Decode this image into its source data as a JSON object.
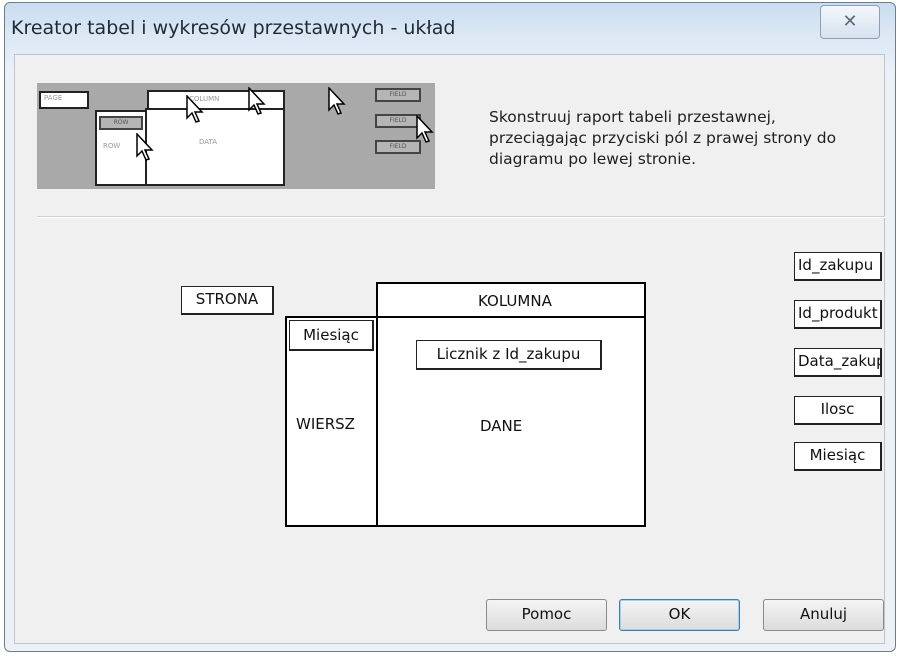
{
  "window": {
    "title": "Kreator tabel i wykresów przestawnych - układ",
    "close_glyph": "☒"
  },
  "instruction": "Skonstruuj raport tabeli przestawnej, przeciągając przyciski pól z prawej strony do diagramu po lewej stronie.",
  "layout": {
    "page_label": "STRONA",
    "column_label": "KOLUMNA",
    "row_label": "WIERSZ",
    "data_label": "DANE",
    "row_field": "Miesiąc",
    "data_field": "Licznik z Id_zakupu"
  },
  "fields": [
    "Id_zakupu",
    "Id_produkt",
    "Data_zakupu",
    "Ilosc",
    "Miesiąc"
  ],
  "buttons": {
    "help": "Pomoc",
    "ok": "OK",
    "cancel": "Anuluj"
  },
  "colors": {
    "titlebar": "#c9dcef",
    "client": "#f0f0f0",
    "ok_border": "#3c7fb1"
  }
}
